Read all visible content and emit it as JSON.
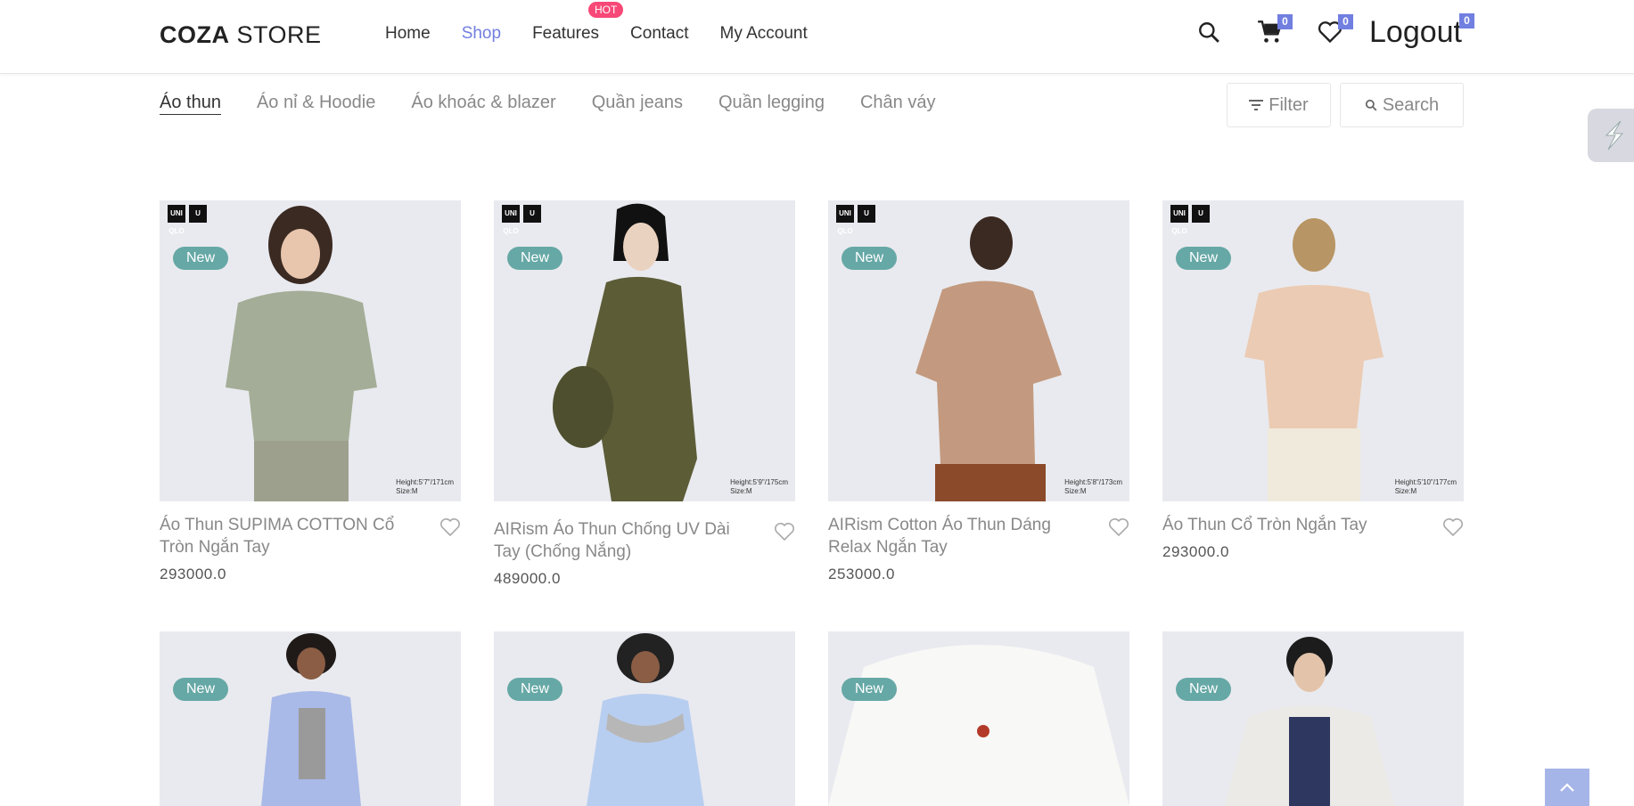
{
  "header": {
    "logo_bold": "COZA",
    "logo_light": " STORE",
    "nav": [
      "Home",
      "Shop",
      "Features",
      "Contact",
      "My Account"
    ],
    "hot_badge": "HOT",
    "cart_count": "0",
    "wishlist_count": "0",
    "logout_label": "Logout",
    "logout_count": "0"
  },
  "categories": [
    "Áo thun",
    "Áo nỉ & Hoodie",
    "Áo khoác & blazer",
    "Quần jeans",
    "Quần legging",
    "Chân váy"
  ],
  "toolbar": {
    "filter_label": "Filter",
    "search_label": "Search"
  },
  "badge_label": "New",
  "products": [
    {
      "name": "Áo Thun SUPIMA COTTON Cổ Tròn Ngắn Tay",
      "price": "293000.0",
      "meta1": "Height:5'7\"/171cm",
      "meta2": "Size:M"
    },
    {
      "name": "AIRism Áo Thun Chống UV Dài Tay (Chống Nắng)",
      "price": "489000.0",
      "meta1": "Height:5'9\"/175cm",
      "meta2": "Size:M"
    },
    {
      "name": "AIRism Cotton Áo Thun Dáng Relax Ngắn Tay",
      "price": "253000.0",
      "meta1": "Height:5'8\"/173cm",
      "meta2": "Size:M"
    },
    {
      "name": "Áo Thun Cổ Tròn Ngắn Tay",
      "price": "293000.0",
      "meta1": "Height:5'10\"/177cm",
      "meta2": "Size:M"
    }
  ],
  "colors": {
    "accent": "#717fe0",
    "hot": "#f74877",
    "badge": "#66a8a6"
  }
}
